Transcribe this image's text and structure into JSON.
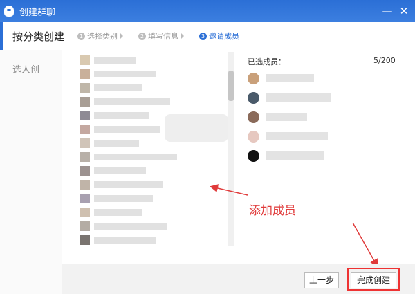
{
  "window": {
    "title": "创建群聊",
    "minimize_symbol": "—",
    "close_symbol": "✕"
  },
  "header": {
    "title": "按分类创建",
    "steps": [
      {
        "num": "1",
        "label": "选择类别",
        "active": false
      },
      {
        "num": "2",
        "label": "填写信息",
        "active": false
      },
      {
        "num": "3",
        "label": "邀请成员",
        "active": true
      }
    ]
  },
  "sidebar": {
    "label": "选人创"
  },
  "selected_panel": {
    "title": "已选成员：",
    "count": "5/200"
  },
  "annotation": {
    "text": "添加成员",
    "color": "#e03a3a"
  },
  "footer": {
    "prev_label": "上一步",
    "finish_label": "完成创建"
  },
  "colors": {
    "accent": "#2b6fd6",
    "highlight": "#e33333"
  }
}
